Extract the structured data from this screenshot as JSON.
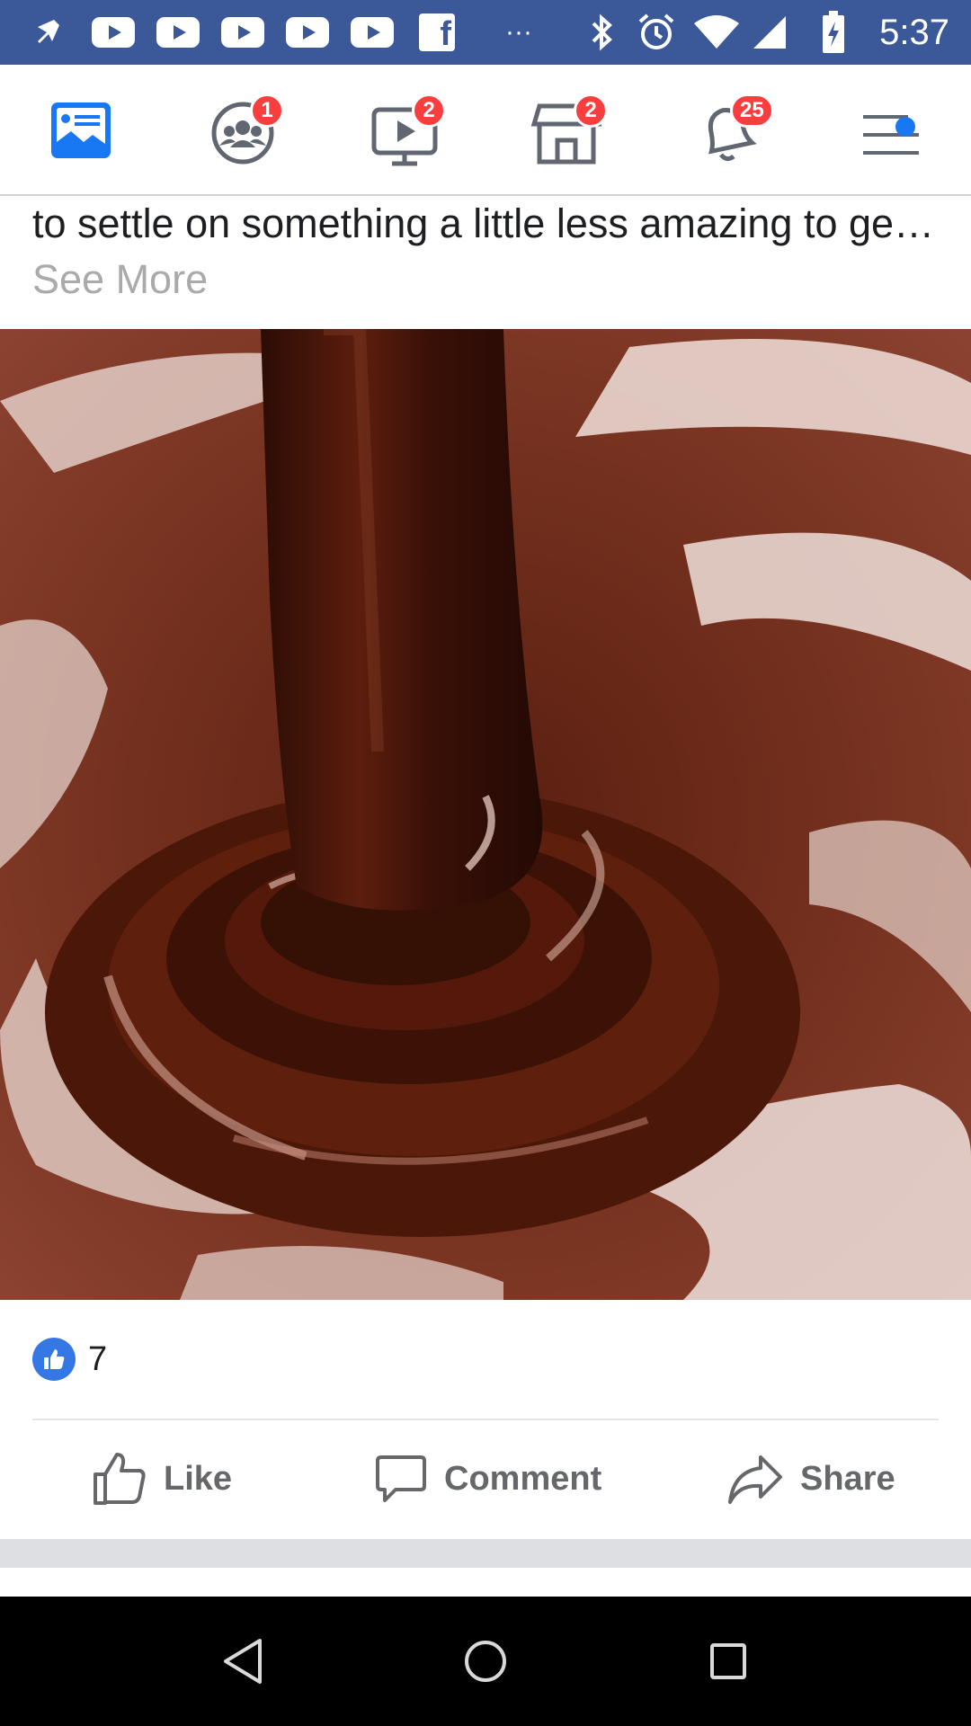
{
  "status_bar": {
    "time": "5:37",
    "icons": [
      "notification-pin-icon",
      "youtube-icon",
      "youtube-icon",
      "youtube-icon",
      "youtube-icon",
      "youtube-icon",
      "facebook-icon",
      "more-notifications-icon",
      "bluetooth-icon",
      "alarm-icon",
      "wifi-icon",
      "signal-icon",
      "battery-charging-icon"
    ],
    "overflow": "···"
  },
  "nav": {
    "items": [
      {
        "name": "news-feed",
        "icon": "news-feed-icon",
        "badge": "",
        "active": true
      },
      {
        "name": "groups",
        "icon": "groups-icon",
        "badge": "1"
      },
      {
        "name": "watch",
        "icon": "watch-icon",
        "badge": "2"
      },
      {
        "name": "marketplace",
        "icon": "marketplace-icon",
        "badge": "2"
      },
      {
        "name": "notifications",
        "icon": "bell-icon",
        "badge": "25"
      },
      {
        "name": "menu",
        "icon": "menu-icon",
        "badge": ""
      }
    ],
    "active_color": "#1877f2",
    "badge_color": "#fa3e3e"
  },
  "post": {
    "text": "to settle on something a little less amazing to ge…",
    "see_more": "See More",
    "image": "melted-chocolate-photo",
    "reaction_count": "7",
    "actions": {
      "like": "Like",
      "comment": "Comment",
      "share": "Share"
    }
  },
  "android_nav": {
    "buttons": [
      "back-icon",
      "home-icon",
      "recents-icon"
    ]
  }
}
